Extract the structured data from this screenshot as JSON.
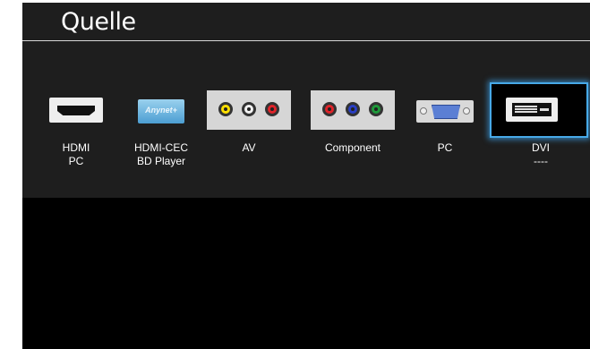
{
  "header": {
    "title": "Quelle"
  },
  "sources": [
    {
      "id": "hdmi",
      "line1": "HDMI",
      "line2": "PC",
      "icon": "hdmi-port-icon",
      "selected": false
    },
    {
      "id": "hdmi-cec",
      "line1": "HDMI-CEC",
      "line2": "BD Player",
      "icon": "anynet-icon",
      "logo_text": "Anynet+",
      "selected": false
    },
    {
      "id": "av",
      "line1": "AV",
      "line2": "",
      "icon": "rca-av-icon",
      "selected": false
    },
    {
      "id": "component",
      "line1": "Component",
      "line2": "",
      "icon": "component-icon",
      "selected": false
    },
    {
      "id": "pc",
      "line1": "PC",
      "line2": "",
      "icon": "vga-icon",
      "selected": false
    },
    {
      "id": "dvi",
      "line1": "DVI",
      "line2": "----",
      "icon": "dvi-port-icon",
      "selected": true
    }
  ],
  "colors": {
    "panel": "#1e1e1e",
    "selected_text": "#c3d72e",
    "selection_border": "#47a9e8",
    "av_jacks": [
      "#ffe000",
      "#f2f2f2",
      "#e0242a"
    ],
    "component_jacks": [
      "#e0242a",
      "#2a3fc4",
      "#1e9a3a"
    ]
  }
}
